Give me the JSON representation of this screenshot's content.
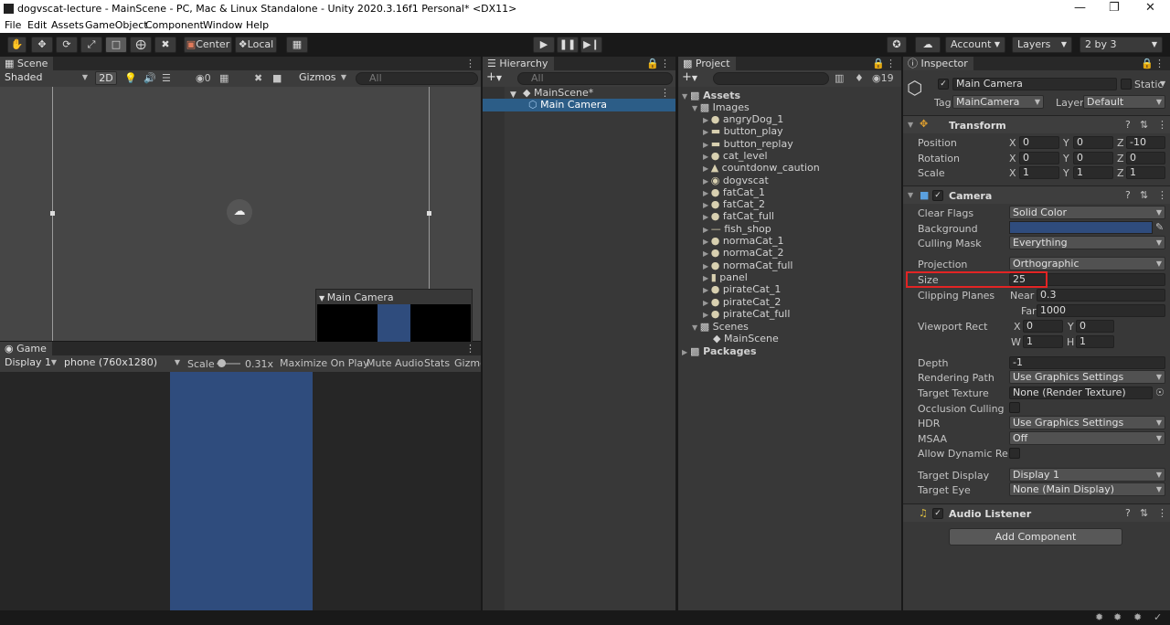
{
  "window": {
    "title": "dogvscat-lecture - MainScene - PC, Mac & Linux Standalone - Unity 2020.3.16f1 Personal* <DX11>"
  },
  "menu": [
    "File",
    "Edit",
    "Assets",
    "GameObject",
    "Component",
    "Window",
    "Help"
  ],
  "toolbar": {
    "pivot_label": "Center",
    "space_label": "Local",
    "account_label": "Account",
    "layers_label": "Layers",
    "layout_label": "2 by 3"
  },
  "scene": {
    "tab": "Scene",
    "shading": "Shaded",
    "mode_2d": "2D",
    "hidden_count": "0",
    "gizmos": "Gizmos",
    "search_placeholder": "All",
    "camera_preview_title": "Main Camera"
  },
  "game": {
    "tab": "Game",
    "display": "Display 1",
    "resolution": "phone (760x1280)",
    "scale_label": "Scale",
    "scale_value": "0.31x",
    "maximize": "Maximize On Play",
    "mute": "Mute Audio",
    "stats": "Stats",
    "gizmos": "Gizmo"
  },
  "hierarchy": {
    "tab": "Hierarchy",
    "search_placeholder": "All",
    "scene_name": "MainScene*",
    "items": [
      "Main Camera"
    ]
  },
  "project": {
    "tab": "Project",
    "hidden_count": "19",
    "assets": "Assets",
    "images_folder": "Images",
    "images": [
      "angryDog_1",
      "button_play",
      "button_replay",
      "cat_level",
      "countdonw_caution",
      "dogvscat",
      "fatCat_1",
      "fatCat_2",
      "fatCat_full",
      "fish_shop",
      "normaCat_1",
      "normaCat_2",
      "normaCat_full",
      "panel",
      "pirateCat_1",
      "pirateCat_2",
      "pirateCat_full"
    ],
    "scenes_folder": "Scenes",
    "scenes": [
      "MainScene"
    ],
    "packages": "Packages"
  },
  "inspector": {
    "tab": "Inspector",
    "object_name": "Main Camera",
    "static_label": "Static",
    "tag_label": "Tag",
    "tag_value": "MainCamera",
    "layer_label": "Layer",
    "layer_value": "Default",
    "transform": {
      "title": "Transform",
      "position_label": "Position",
      "position": [
        "0",
        "0",
        "-10"
      ],
      "rotation_label": "Rotation",
      "rotation": [
        "0",
        "0",
        "0"
      ],
      "scale_label": "Scale",
      "scale": [
        "1",
        "1",
        "1"
      ]
    },
    "camera": {
      "title": "Camera",
      "clear_flags_label": "Clear Flags",
      "clear_flags": "Solid Color",
      "background_label": "Background",
      "background_color": "#2f4c7d",
      "culling_mask_label": "Culling Mask",
      "culling_mask": "Everything",
      "projection_label": "Projection",
      "projection": "Orthographic",
      "size_label": "Size",
      "size": "25",
      "clipping_label": "Clipping Planes",
      "near_label": "Near",
      "near": "0.3",
      "far_label": "Far",
      "far": "1000",
      "viewport_label": "Viewport Rect",
      "vx": "0",
      "vy": "0",
      "vw": "1",
      "vh": "1",
      "depth_label": "Depth",
      "depth": "-1",
      "rendering_path_label": "Rendering Path",
      "rendering_path": "Use Graphics Settings",
      "target_texture_label": "Target Texture",
      "target_texture": "None (Render Texture)",
      "occlusion_label": "Occlusion Culling",
      "hdr_label": "HDR",
      "hdr": "Use Graphics Settings",
      "msaa_label": "MSAA",
      "msaa": "Off",
      "dynamic_res_label": "Allow Dynamic Reso",
      "target_display_label": "Target Display",
      "target_display": "Display 1",
      "target_eye_label": "Target Eye",
      "target_eye": "None (Main Display)"
    },
    "audio_listener": "Audio Listener",
    "add_component": "Add Component"
  },
  "colors": {
    "highlight": "#e22424",
    "selection": "#2c5d87",
    "camera_bg": "#2f4c7d"
  }
}
